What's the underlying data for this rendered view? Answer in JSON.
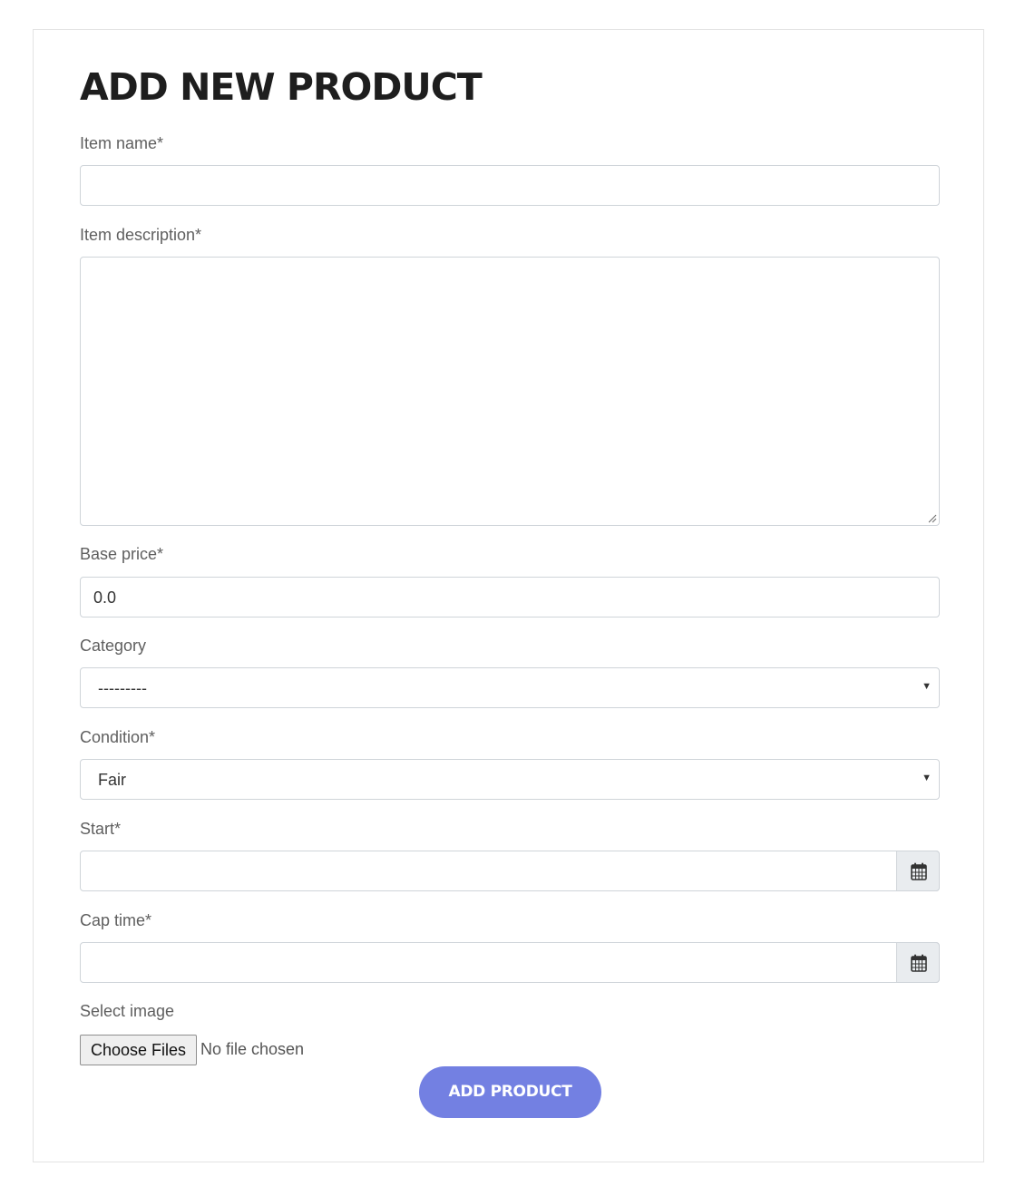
{
  "page": {
    "title": "ADD NEW PRODUCT"
  },
  "form": {
    "item_name": {
      "label": "Item name*",
      "value": ""
    },
    "item_description": {
      "label": "Item description*",
      "value": ""
    },
    "base_price": {
      "label": "Base price*",
      "value": "0.0"
    },
    "category": {
      "label": "Category",
      "selected": "---------"
    },
    "condition": {
      "label": "Condition*",
      "selected": "Fair"
    },
    "start": {
      "label": "Start*",
      "value": "",
      "icon": "calendar-icon"
    },
    "cap_time": {
      "label": "Cap time*",
      "value": "",
      "icon": "calendar-icon"
    },
    "image": {
      "label": "Select image",
      "button_label": "Choose Files",
      "status": "No file chosen"
    },
    "submit_label": "ADD PRODUCT"
  },
  "colors": {
    "accent": "#7380e2",
    "title": "#1e1e1e",
    "label": "#5f5f5f",
    "border": "#cfd4d9",
    "addon_bg": "#e9ecef"
  }
}
